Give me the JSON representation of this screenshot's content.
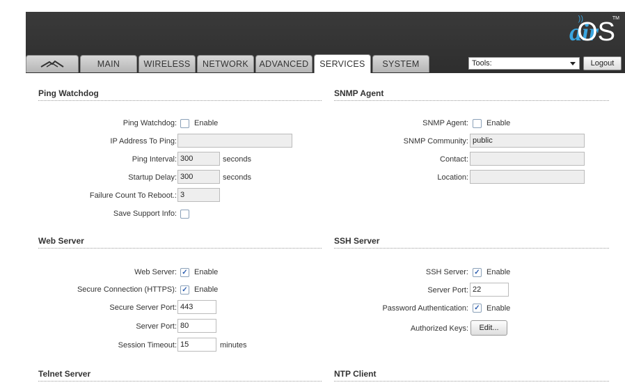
{
  "brand": {
    "air": "air",
    "os": "OS",
    "tm": "TM"
  },
  "tabs": [
    {
      "label": "",
      "icon": "ubiquiti-logo-icon"
    },
    {
      "label": "MAIN"
    },
    {
      "label": "WIRELESS"
    },
    {
      "label": "NETWORK"
    },
    {
      "label": "ADVANCED"
    },
    {
      "label": "SERVICES",
      "active": true
    },
    {
      "label": "SYSTEM"
    }
  ],
  "tools": {
    "value": "Tools:"
  },
  "logout_label": "Logout",
  "ping": {
    "title": "Ping Watchdog",
    "watchdog_label": "Ping Watchdog:",
    "enable": "Enable",
    "ip_label": "IP Address To Ping:",
    "ip_value": "",
    "interval_label": "Ping Interval:",
    "interval_value": "300",
    "seconds": "seconds",
    "startup_label": "Startup Delay:",
    "startup_value": "300",
    "failure_label": "Failure Count To Reboot.:",
    "failure_value": "3",
    "support_label": "Save Support Info:"
  },
  "snmp": {
    "title": "SNMP Agent",
    "agent_label": "SNMP Agent:",
    "enable": "Enable",
    "community_label": "SNMP Community:",
    "community_value": "public",
    "contact_label": "Contact:",
    "contact_value": "",
    "location_label": "Location:",
    "location_value": ""
  },
  "web": {
    "title": "Web Server",
    "server_label": "Web Server:",
    "enable": "Enable",
    "https_label": "Secure Connection (HTTPS):",
    "secure_port_label": "Secure Server Port:",
    "secure_port_value": "443",
    "port_label": "Server Port:",
    "port_value": "80",
    "timeout_label": "Session Timeout:",
    "timeout_value": "15",
    "minutes": "minutes"
  },
  "ssh": {
    "title": "SSH Server",
    "server_label": "SSH Server:",
    "enable": "Enable",
    "port_label": "Server Port:",
    "port_value": "22",
    "password_label": "Password Authentication:",
    "keys_label": "Authorized Keys:",
    "edit_label": "Edit..."
  },
  "telnet": {
    "title": "Telnet Server"
  },
  "ntp": {
    "title": "NTP Client"
  },
  "check_mark": "✓"
}
